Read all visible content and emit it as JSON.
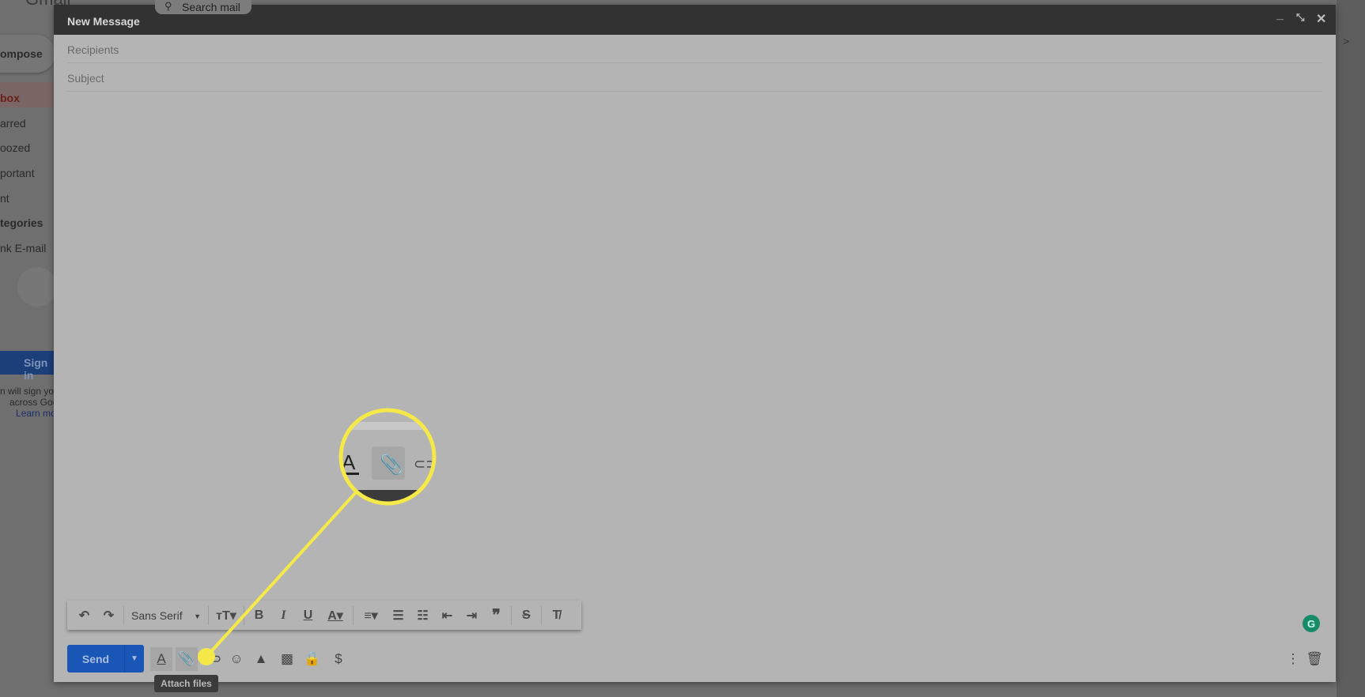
{
  "background": {
    "app_name_partial": "Gmail",
    "search_placeholder_partial": "Search mail",
    "compose_partial": "ompose",
    "nav": [
      "box",
      "arred",
      "oozed",
      "portant",
      "nt",
      "tegories",
      "nk E-mail"
    ],
    "signin_partial": "Sign in",
    "signin_text": [
      "n will sign you",
      "across Goo"
    ],
    "learn_more_partial": "Learn mo"
  },
  "dialog": {
    "title": "New Message",
    "recipients_placeholder": "Recipients",
    "subject_placeholder": "Subject"
  },
  "format_toolbar": {
    "font": "Sans Serif"
  },
  "bottom": {
    "send_label": "Send",
    "tooltip": "Attach files"
  },
  "colors": {
    "accent": "#1a56b5",
    "highlight": "#f5e94a",
    "grammarly": "#178a66"
  }
}
